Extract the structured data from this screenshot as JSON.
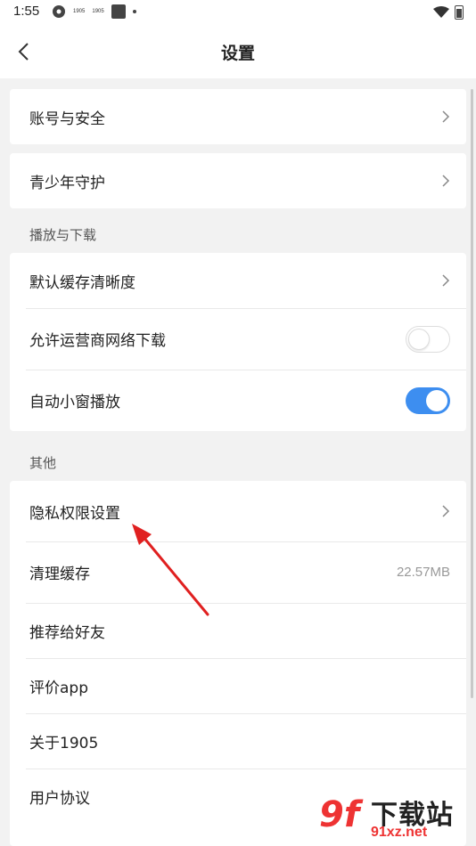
{
  "status_bar": {
    "time": "1:55",
    "tiny_label_1": "1905",
    "tiny_label_2": "1905",
    "icons": [
      "app-icon",
      "square-icon",
      "dot-icon",
      "wifi-icon",
      "battery-icon"
    ]
  },
  "header": {
    "title": "设置",
    "back_icon": "chevron-left-icon"
  },
  "groups": {
    "account": {
      "label": "账号与安全"
    },
    "youth": {
      "label": "青少年守护"
    },
    "play_download": {
      "section_title": "播放与下载",
      "items": [
        {
          "label": "默认缓存清晰度",
          "control": "chevron"
        },
        {
          "label": "允许运营商网络下载",
          "control": "toggle",
          "checked": false
        },
        {
          "label": "自动小窗播放",
          "control": "toggle",
          "checked": true
        }
      ]
    },
    "other": {
      "section_title": "其他",
      "items": [
        {
          "label": "隐私权限设置",
          "control": "chevron"
        },
        {
          "label": "清理缓存",
          "value": "22.57MB"
        },
        {
          "label": "推荐给好友"
        },
        {
          "label": "评价app"
        },
        {
          "label": "关于1905"
        },
        {
          "label": "用户协议"
        }
      ]
    }
  },
  "colors": {
    "accent": "#3d8ef0",
    "annotation_arrow": "#e02020",
    "watermark_red": "#e33333"
  },
  "watermark": {
    "logo": "9f",
    "text": "下载站",
    "url": "91xz.net"
  }
}
